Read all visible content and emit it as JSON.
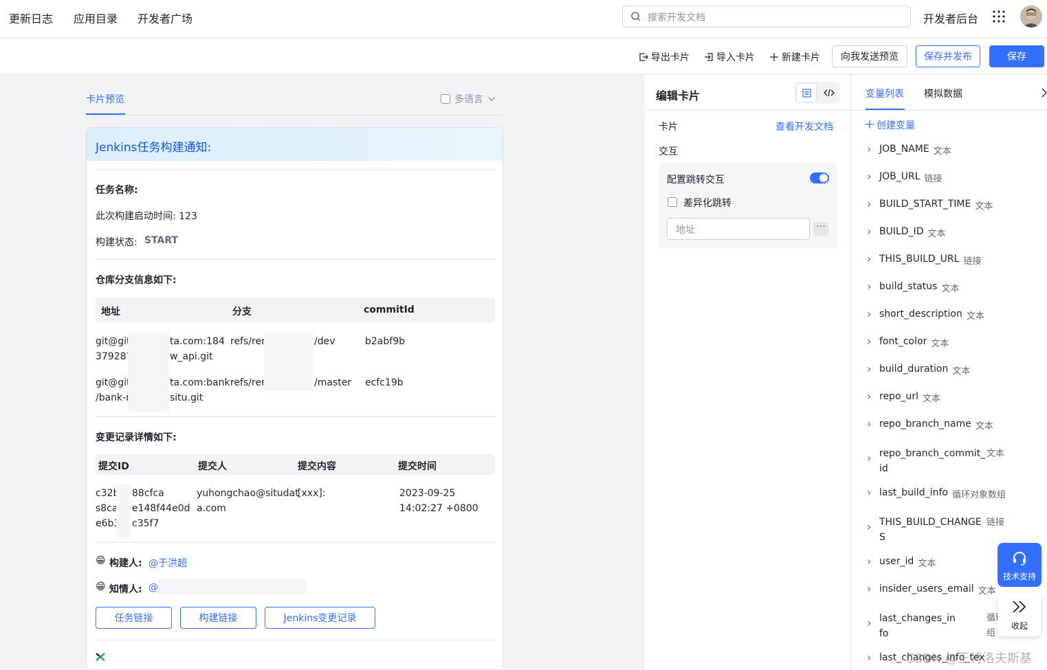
{
  "topbar": {
    "nav": [
      "更新日志",
      "应用目录",
      "开发者广场"
    ],
    "search_placeholder": "搜索开发文档",
    "dev_console": "开发者后台"
  },
  "toolbar": {
    "export": "导出卡片",
    "import": "导入卡片",
    "new": "新建卡片",
    "send_preview": "向我发送预览",
    "save_publish": "保存并发布",
    "save": "保存"
  },
  "preview": {
    "tab": "卡片预览",
    "multilang": "多语言"
  },
  "card": {
    "title": "Jenkins任务构建通知:",
    "task_name": "任务名称:",
    "start_time": "此次构建启动时间: 123",
    "status_label": "构建状态:",
    "status_value": "START",
    "repo_title": "仓库分支信息如下:",
    "repo_headers": [
      "地址",
      "分支",
      "commitId"
    ],
    "repo_rows": [
      {
        "addr1": "git@git",
        "addr1b": "ta.com:184",
        "addr2": "379287",
        "addr2b": "w_api.git",
        "branch": "refs/ren",
        "branchb": "/dev",
        "commit": "b2abf9b"
      },
      {
        "addr1": "git@git",
        "addr1b": "ta.com:bank",
        "addr2": "/bank-r",
        "addr2b": "situ.git",
        "branch": "refs/ren",
        "branchb": "/master",
        "commit": "ecfc19b"
      }
    ],
    "changes_title": "变更记录详情如下:",
    "change_headers": [
      "提交ID",
      "提交人",
      "提交内容",
      "提交时间"
    ],
    "change_row": {
      "id1": "c32b",
      "id1b": "88cfca",
      "id2": "s8ca",
      "id2b": "e148f44e0d",
      "id3": "e6b3",
      "id3b": "c35f7",
      "author1": "yuhongchao@situdat",
      "author2": "a.com",
      "content": "[xxx]:",
      "time1": "2023-09-25",
      "time2": "14:02:27 +0800"
    },
    "builder_label": "构建人:",
    "builder_value": "@于洪超",
    "insider_label": "知情人:",
    "insider_value": "@",
    "buttons": [
      "任务链接",
      "构建链接",
      "Jenkins变更记录"
    ],
    "emoji": "😁"
  },
  "editor": {
    "title": "编辑卡片",
    "card_label": "卡片",
    "doc_link": "查看开发文档",
    "interaction": "交互",
    "config_jump": "配置跳转交互",
    "diff_jump": "差异化跳转",
    "addr_placeholder": "地址",
    "more": "···"
  },
  "vars": {
    "tab_list": "变量列表",
    "tab_mock": "模拟数据",
    "create": "创建变量",
    "items": [
      {
        "name": "JOB_NAME",
        "type": "文本"
      },
      {
        "name": "JOB_URL",
        "type": "链接"
      },
      {
        "name": "BUILD_START_TIME",
        "type": "文本"
      },
      {
        "name": "BUILD_ID",
        "type": "文本"
      },
      {
        "name": "THIS_BUILD_URL",
        "type": "链接"
      },
      {
        "name": "build_status",
        "type": "文本"
      },
      {
        "name": "short_description",
        "type": "文本"
      },
      {
        "name": "font_color",
        "type": "文本"
      },
      {
        "name": "build_duration",
        "type": "文本"
      },
      {
        "name": "repo_url",
        "type": "文本"
      },
      {
        "name": "repo_branch_name",
        "type": "文本"
      },
      {
        "name": "repo_branch_commit_",
        "name2": "id",
        "type": "文本"
      },
      {
        "name": "last_build_info",
        "type": "循环对象数组"
      },
      {
        "name": "THIS_BUILD_CHANGE",
        "name2": "S",
        "type": "链接"
      },
      {
        "name": "user_id",
        "type": "文本"
      },
      {
        "name": "insider_users_email",
        "type": "文本"
      },
      {
        "name": "last_changes_in",
        "name2": "fo",
        "type": "循环对象",
        "type2": "组"
      },
      {
        "name": "last_changes_info_tex",
        "type": ""
      }
    ]
  },
  "float": {
    "support": "技术支持",
    "collapse": "收起"
  },
  "watermark": "CSDN @王特洛夫斯基",
  "colors": {
    "accent": "#3370ff",
    "header_title": "#1456f0",
    "panel_bg": "#f2f3f5"
  }
}
